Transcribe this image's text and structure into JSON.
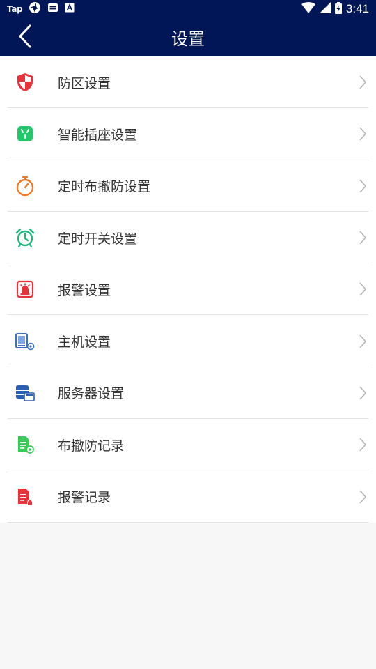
{
  "status_bar": {
    "app_label": "Tap",
    "time": "3:41"
  },
  "header": {
    "title": "设置",
    "back_icon": "chevron-left-icon"
  },
  "menu": {
    "items": [
      {
        "label": "防区设置",
        "icon": "shield-icon",
        "color": "#e8333a"
      },
      {
        "label": "智能插座设置",
        "icon": "smart-plug-icon",
        "color": "#22c76a"
      },
      {
        "label": "定时布撤防设置",
        "icon": "stopwatch-icon",
        "color": "#f07a2a"
      },
      {
        "label": "定时开关设置",
        "icon": "alarm-clock-icon",
        "color": "#1fb87a"
      },
      {
        "label": "报警设置",
        "icon": "siren-icon",
        "color": "#e8333a"
      },
      {
        "label": "主机设置",
        "icon": "host-settings-icon",
        "color": "#3b6fc4"
      },
      {
        "label": "服务器设置",
        "icon": "server-icon",
        "color": "#2a5fb5"
      },
      {
        "label": "布撤防记录",
        "icon": "arm-record-icon",
        "color": "#3ccb5a"
      },
      {
        "label": "报警记录",
        "icon": "alarm-record-icon",
        "color": "#e8333a"
      }
    ]
  },
  "colors": {
    "primary": "#001656",
    "divider": "#e2e2e2",
    "chevron": "#b5b5b5",
    "background": "#f7f7f7"
  }
}
